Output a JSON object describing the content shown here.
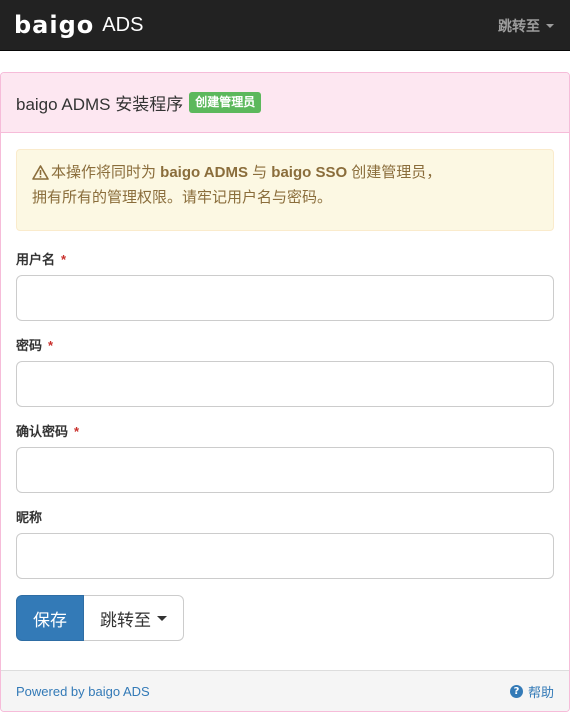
{
  "navbar": {
    "logo_word": "baigo",
    "logo_suffix": "ADS",
    "jump_label": "跳转至"
  },
  "panel": {
    "title": "baigo ADMS 安装程序",
    "badge": "创建管理员",
    "alert": {
      "icon": "warning-icon",
      "text_part1": "本操作将同时为 ",
      "bold1": "baigo ADMS",
      "text_part2": " 与 ",
      "bold2": "baigo SSO",
      "text_part3": " 创建管理员，",
      "line2": "拥有所有的管理权限。请牢记用户名与密码。"
    },
    "fields": [
      {
        "label": "用户名",
        "required": "*",
        "value": ""
      },
      {
        "label": "密码",
        "required": "*",
        "value": ""
      },
      {
        "label": "确认密码",
        "required": "*",
        "value": ""
      },
      {
        "label": "昵称",
        "required": "",
        "value": ""
      }
    ],
    "buttons": {
      "save": "保存",
      "jump": "跳转至"
    },
    "footer": {
      "powered": "Powered by baigo ADS",
      "help": "帮助",
      "help_icon": "question-circle-icon"
    }
  },
  "colors": {
    "navbar_bg": "#222222",
    "panel_heading_bg": "#fde7f1",
    "panel_border": "#f6bcd9",
    "badge_green": "#5cb85c",
    "alert_bg": "#fcf8e3",
    "alert_text": "#8a6d3b",
    "primary": "#337ab7",
    "required": "#c9302c"
  }
}
